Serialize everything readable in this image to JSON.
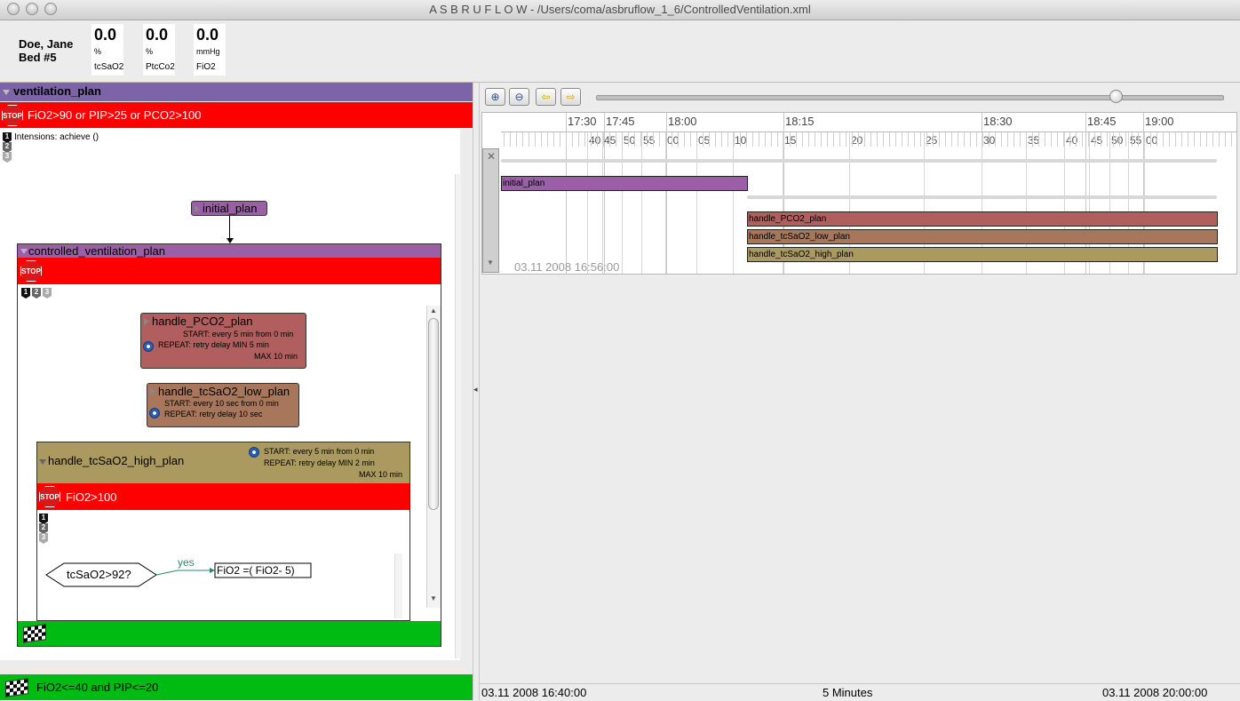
{
  "window": {
    "title": "A S B R U   F L O W - /Users/coma/asbruflow_1_6/ControlledVentilation.xml"
  },
  "patient": {
    "name": "Doe, Jane",
    "bed": "Bed #5"
  },
  "vitals": [
    {
      "value": "0.0",
      "unit": "%",
      "name": "tcSaO2"
    },
    {
      "value": "0.0",
      "unit": "%",
      "name": "PtcCo2"
    },
    {
      "value": "0.0",
      "unit": "mmHg",
      "name": "FiO2"
    }
  ],
  "plan": {
    "name": "ventilation_plan",
    "abort_condition": "FiO2>90 or PIP>25 or PCO2>100",
    "intentions": "Intensions: achieve ()",
    "step_numbers": [
      "1",
      "2",
      "3"
    ],
    "stop_label": "STOP",
    "complete_condition": "FiO2<=40 and PIP<=20",
    "initial": "initial_plan",
    "controlled": {
      "name": "controlled_ventilation_plan",
      "subplans": [
        {
          "name": "handle_PCO2_plan",
          "start": "START: every 5 min from 0 min",
          "repeat": "REPEAT: retry delay MIN 5 min",
          "max": "MAX 10 min",
          "color": "#b05e5e"
        },
        {
          "name": "handle_tcSaO2_low_plan",
          "start": "START: every 10 sec from 0 min",
          "repeat": "REPEAT: retry delay 10 sec",
          "color": "#a8775b"
        },
        {
          "name": "handle_tcSaO2_high_plan",
          "start": "START: every 5 min from 0 min",
          "repeat": "REPEAT: retry delay MIN 2 min",
          "max": "MAX 10 min",
          "color": "#aa9a60",
          "abort_condition": "FiO2>100"
        }
      ],
      "decision": {
        "condition": "tcSaO2>92?",
        "branch": "yes",
        "action": "FiO2 =( FiO2- 5)"
      }
    }
  },
  "timeline": {
    "hours": [
      "17:30",
      "17:45",
      "18:00",
      "18:15",
      "18:30",
      "18:45",
      "19:00"
    ],
    "minutes": [
      "40",
      "45",
      "50",
      "55",
      "00",
      "05",
      "10",
      "15",
      "20",
      "25",
      "30",
      "35",
      "40",
      "45",
      "50",
      "55",
      "00"
    ],
    "bars": [
      {
        "name": "initial_plan",
        "color": "#9b5fa8"
      },
      {
        "name": "handle_PCO2_plan",
        "color": "#b05e5e"
      },
      {
        "name": "handle_tcSaO2_low_plan",
        "color": "#a8775b"
      },
      {
        "name": "handle_tcSaO2_high_plan",
        "color": "#aa9a60"
      }
    ],
    "watermark": "03.11 2008 16:56:00"
  },
  "status": {
    "start": "03.11 2008 16:40:00",
    "scale": "5 Minutes",
    "end": "03.11 2008 20:00:00"
  },
  "colors": {
    "plan_header": "#7d63a8",
    "abort_red": "#ff0000",
    "complete_green": "#00bb11"
  },
  "zoom_slider": 0.83
}
